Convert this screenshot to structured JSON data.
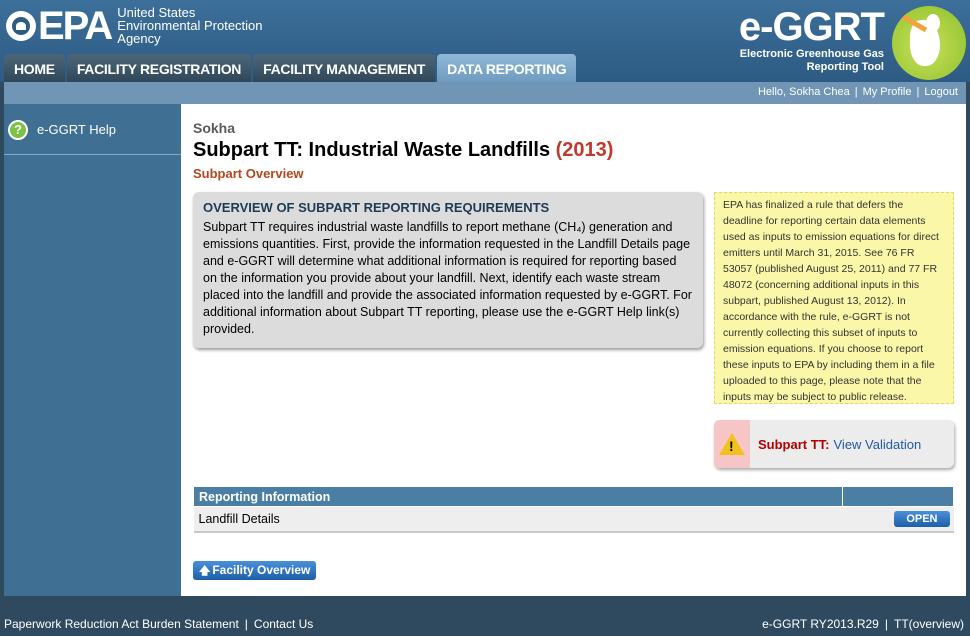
{
  "header": {
    "agency_line1": "United States",
    "agency_line2": "Environmental Protection",
    "agency_line3": "Agency",
    "logo_text": "EPA",
    "product_title": "e-GGRT",
    "product_sub1": "Electronic Greenhouse Gas",
    "product_sub2": "Reporting Tool"
  },
  "nav": {
    "tabs": [
      {
        "label": "HOME"
      },
      {
        "label": "FACILITY REGISTRATION"
      },
      {
        "label": "FACILITY MANAGEMENT"
      },
      {
        "label": "DATA REPORTING"
      }
    ],
    "active": "DATA REPORTING"
  },
  "userbar": {
    "greeting": "Hello, Sokha Chea",
    "profile": "My Profile",
    "logout": "Logout"
  },
  "sidebar": {
    "help_label": "e-GGRT Help",
    "help_icon": "question-icon"
  },
  "main": {
    "facility_name": "Sokha",
    "subpart_title": "Subpart TT: Industrial Waste Landfills",
    "subpart_year": "(2013)",
    "subpart_overview": "Subpart Overview",
    "overview_heading": "OVERVIEW OF SUBPART REPORTING REQUIREMENTS",
    "overview_text": "Subpart TT requires industrial waste landfills to report methane (CH₄) generation and emissions quantities. First, provide the information requested in the Landfill Details page and e-GGRT will determine what additional information is required for reporting based on the information you provide about your landfill. Next, identify each waste stream placed into the landfill and provide the associated information requested by e-GGRT. For additional information about Subpart TT reporting, please use the e-GGRT Help link(s) provided.",
    "notice_text": "EPA has finalized a rule that defers the deadline for reporting certain data elements used as inputs to emission equations for direct emitters until March 31, 2015. See 76 FR 53057 (published August 25, 2011) and 77 FR 48072 (concerning additional inputs in this subpart, published August 13, 2012). In accordance with the rule, e-GGRT is not currently collecting this subset of inputs to emission equations. If you choose to report these inputs to EPA by including them in a file uploaded to this page, please note that the inputs may be subject to public release.",
    "validation_label": "Subpart TT:",
    "validation_link": "View Validation",
    "table_header": "Reporting Information",
    "rows": [
      {
        "label": "Landfill Details",
        "button": "OPEN"
      }
    ],
    "facility_button": "Facility Overview"
  },
  "footer": {
    "paperwork": "Paperwork Reduction Act Burden Statement",
    "contact": "Contact Us",
    "version": "e-GGRT RY2013.R29",
    "page_id": "TT(overview)"
  },
  "colors": {
    "header_blue": "#2d5b83",
    "accent_red": "#c0392b",
    "notice_yellow": "#fbf7a8",
    "button_blue": "#1d5fa8"
  }
}
